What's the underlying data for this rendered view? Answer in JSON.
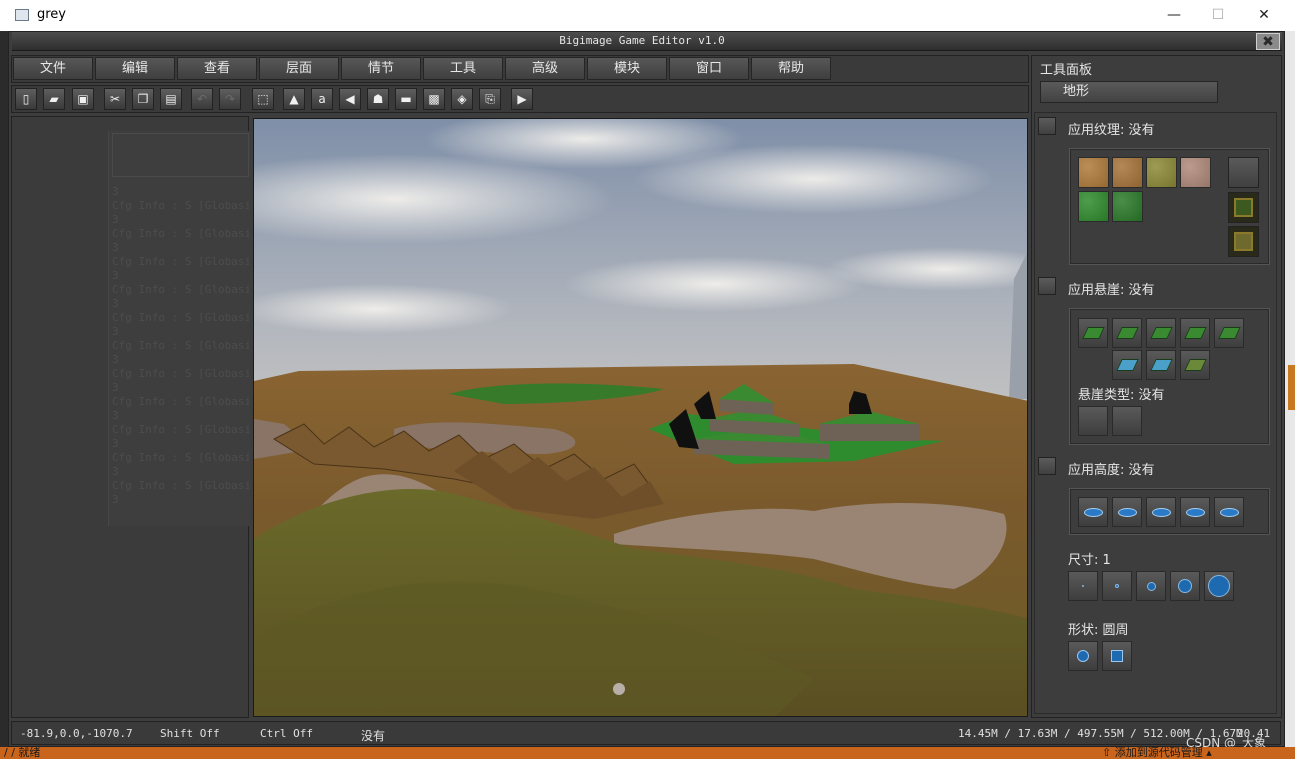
{
  "window": {
    "title": "grey",
    "minimize": "—",
    "maximize": "☐",
    "close": "✕"
  },
  "app": {
    "title": "Bigimage Game Editor v1.0",
    "close": "✖"
  },
  "menu": [
    "文件",
    "编辑",
    "查看",
    "层面",
    "情节",
    "工具",
    "高级",
    "模块",
    "窗口",
    "帮助"
  ],
  "toolbar": [
    {
      "icon": "new-file-icon",
      "glyph": "▯"
    },
    {
      "icon": "open-folder-icon",
      "glyph": "▰"
    },
    {
      "icon": "save-icon",
      "glyph": "▣"
    },
    {
      "icon": "cut-icon",
      "glyph": "✂"
    },
    {
      "icon": "copy-icon",
      "glyph": "❐"
    },
    {
      "icon": "paste-icon",
      "glyph": "▤"
    },
    {
      "icon": "undo-icon",
      "glyph": "↶",
      "disabled": true
    },
    {
      "icon": "redo-icon",
      "glyph": "↷",
      "disabled": true
    },
    {
      "icon": "select-icon",
      "glyph": "⬚"
    },
    {
      "icon": "terrain-icon",
      "glyph": "▲"
    },
    {
      "icon": "text-icon",
      "glyph": "a"
    },
    {
      "icon": "sound-icon",
      "glyph": "◀"
    },
    {
      "icon": "unit-icon",
      "glyph": "☗"
    },
    {
      "icon": "doodad-icon",
      "glyph": "▬"
    },
    {
      "icon": "region-icon",
      "glyph": "▩"
    },
    {
      "icon": "camera-icon",
      "glyph": "◈"
    },
    {
      "icon": "import-icon",
      "glyph": "⎘"
    },
    {
      "icon": "test-map-icon",
      "glyph": "▶"
    }
  ],
  "log_lines": [
    "3",
    "Cfg Info : S [Globasi",
    "3",
    "Cfg Info : S [Globasi",
    "3",
    "Cfg Info : S [Globasi",
    "3",
    "Cfg Info : S [Globasi",
    "3",
    "Cfg Info : S [Globasi",
    "3",
    "Cfg Info : S [Globasi",
    "3",
    "Cfg Info : S [Globasi",
    "3",
    "Cfg Info : S [Globasi",
    "3",
    "Cfg Info : S [Globasi",
    "3",
    "Cfg Info : S [Globasi",
    "3",
    "Cfg Info : S [Globasi",
    "3"
  ],
  "tool_panel": {
    "title": "工具面板",
    "tab": "地形",
    "texture_label": "应用纹理: 没有",
    "textures": [
      {
        "name": "dirt",
        "color": "#b07a3a"
      },
      {
        "name": "dirt-rough",
        "color": "#a8733a"
      },
      {
        "name": "grass-dirt",
        "color": "#8c8a36"
      },
      {
        "name": "rock",
        "color": "#b08a7a"
      },
      {
        "name": "grass",
        "color": "#2e8c2e"
      },
      {
        "name": "grass-dark",
        "color": "#2a7a2a"
      }
    ],
    "cliff_label": "应用悬崖: 没有",
    "cliff_type_label": "悬崖类型: 没有",
    "height_label": "应用高度: 没有",
    "size_label": "尺寸: 1",
    "shape_label": "形状: 圆周"
  },
  "status": {
    "coords": "-81.9,0.0,-1070.7",
    "shift": "Shift Off",
    "ctrl": "Ctrl Off",
    "selection": "没有",
    "memory": "14.45M / 17.63M / 497.55M / 512.00M / 1.67M",
    "fps": "20.41"
  },
  "watermark": "CSDN @_大象_",
  "taskbar": {
    "left_text": "/ / 就绪",
    "right_text": "⇧ 添加到源代码管理 ▴"
  },
  "colors": {
    "panel_bg": "#3d3d3d",
    "accent_orange": "#c8781e"
  }
}
